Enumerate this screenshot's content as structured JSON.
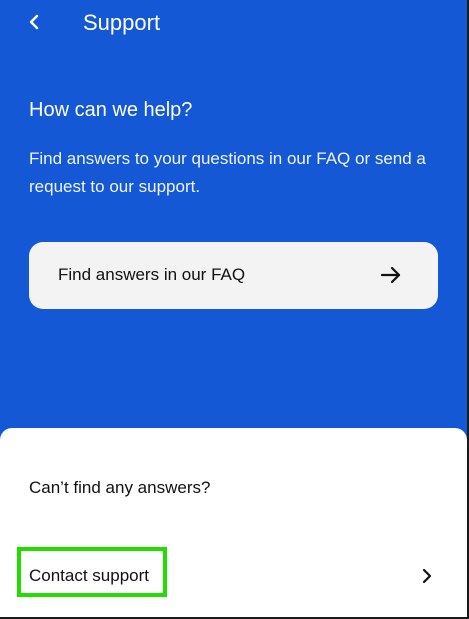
{
  "appbar": {
    "title": "Support",
    "back_icon": "chevron-left-icon"
  },
  "hero": {
    "heading": "How can we help?",
    "description": "Find answers to your questions in our FAQ or send a request to our support."
  },
  "faq_button": {
    "label": "Find answers in our FAQ",
    "icon": "arrow-right-icon"
  },
  "sheet": {
    "heading": "Can’t find any answers?",
    "contact": {
      "label": "Contact support",
      "icon": "chevron-right-icon"
    }
  },
  "colors": {
    "primary_blue": "#1558d6",
    "card_bg": "#f3f3f3",
    "highlight_green": "#22dd00"
  }
}
